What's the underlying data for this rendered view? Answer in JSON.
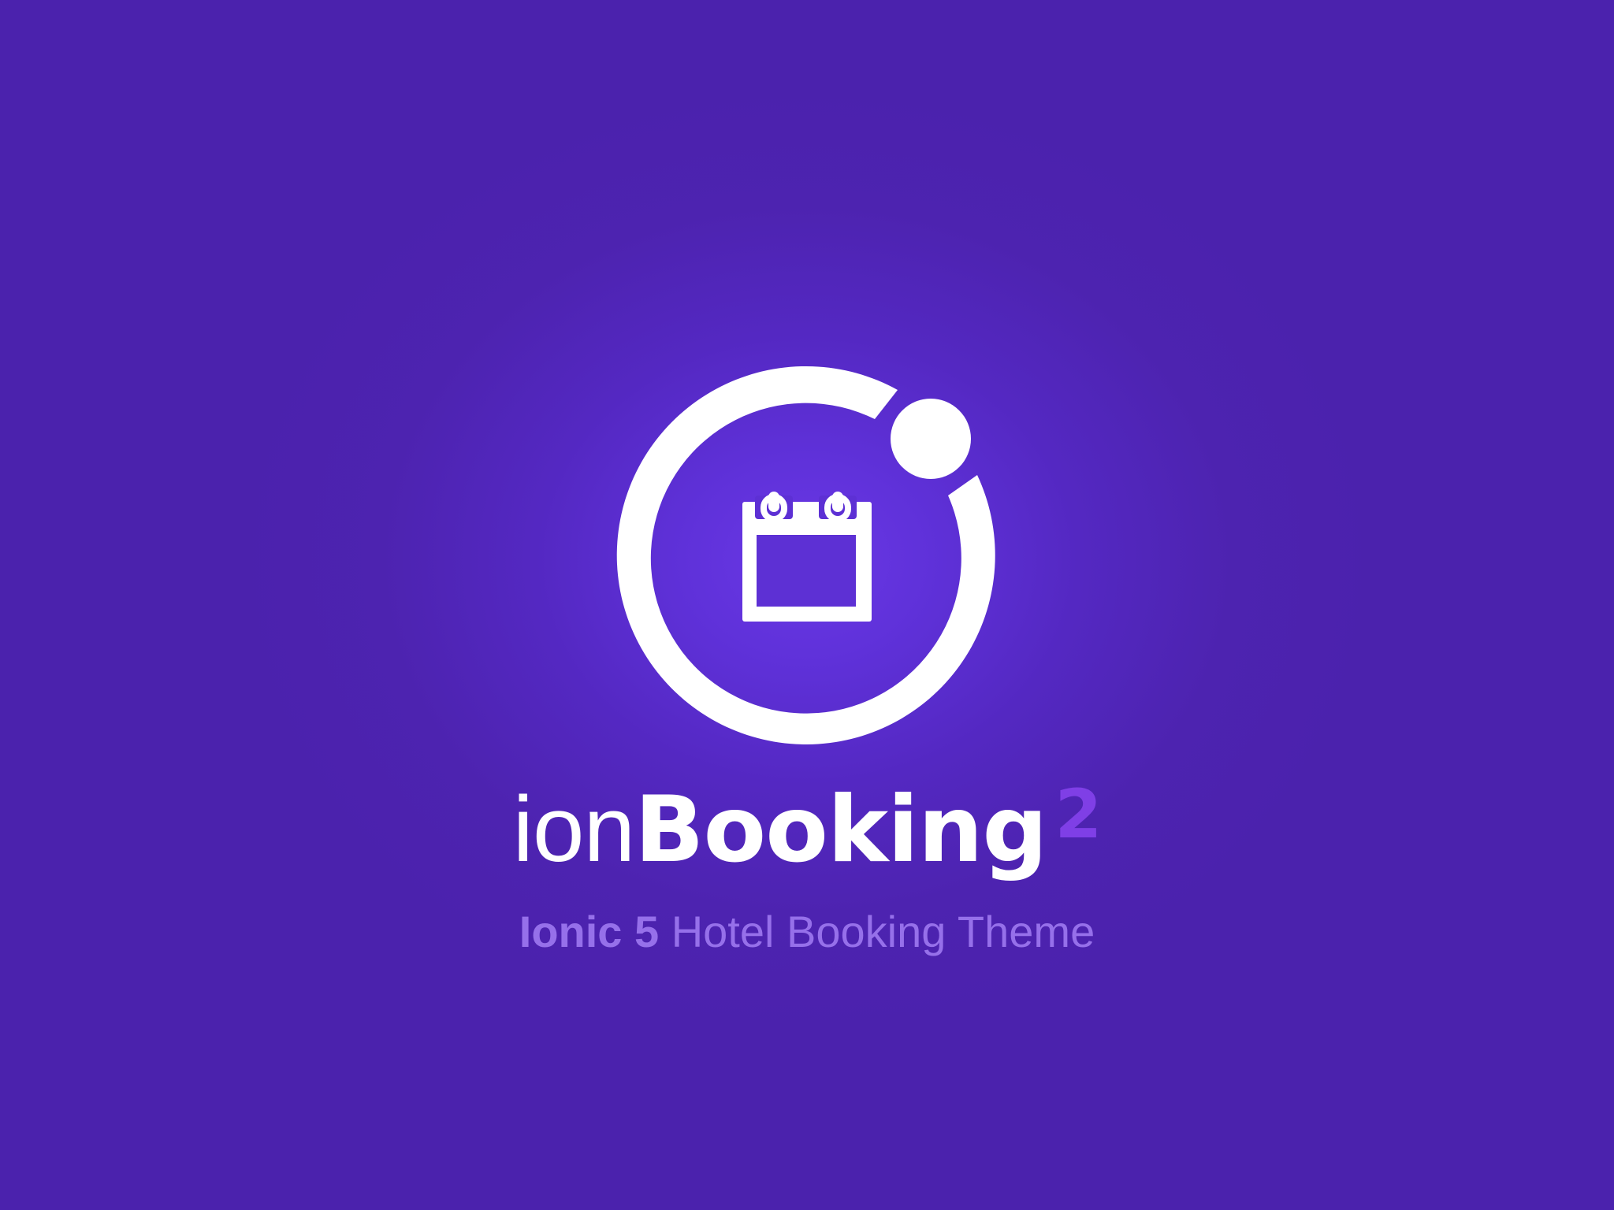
{
  "brand": {
    "prefix": "ion",
    "name": "Booking",
    "version": "2"
  },
  "tagline": {
    "strong": "Ionic 5",
    "rest": " Hotel Booking Theme"
  },
  "logo": {
    "icon": "calendar-icon",
    "ring_color": "#ffffff"
  },
  "colors": {
    "background": "#4b22ad",
    "glow": "#6a38e6",
    "accent": "#7f3fe6",
    "tagline": "#9670ea"
  }
}
